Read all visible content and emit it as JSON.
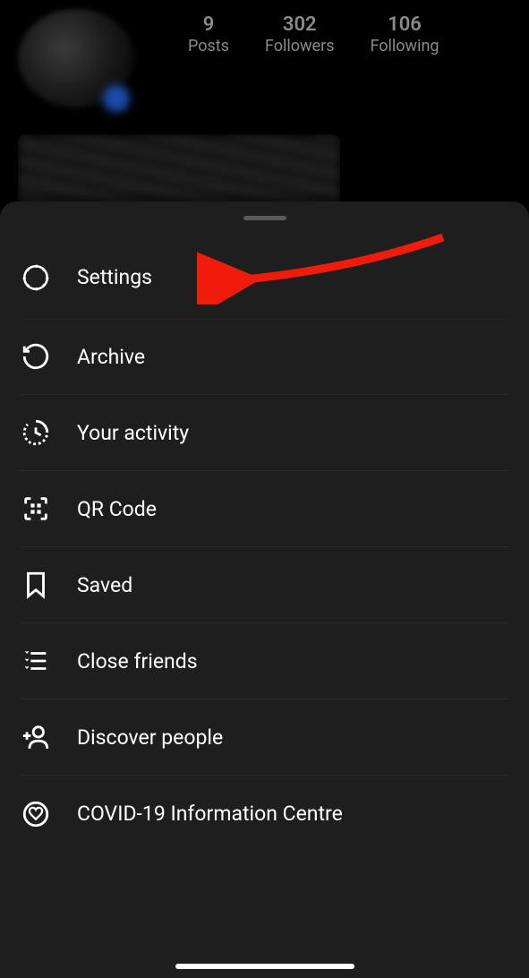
{
  "profile": {
    "stats": {
      "posts": {
        "value": "9",
        "label": "Posts"
      },
      "followers": {
        "value": "302",
        "label": "Followers"
      },
      "following": {
        "value": "106",
        "label": "Following"
      }
    }
  },
  "menu": {
    "settings": "Settings",
    "archive": "Archive",
    "activity": "Your activity",
    "qrcode": "QR Code",
    "saved": "Saved",
    "closefriends": "Close friends",
    "discover": "Discover people",
    "covid": "COVID-19 Information Centre"
  }
}
